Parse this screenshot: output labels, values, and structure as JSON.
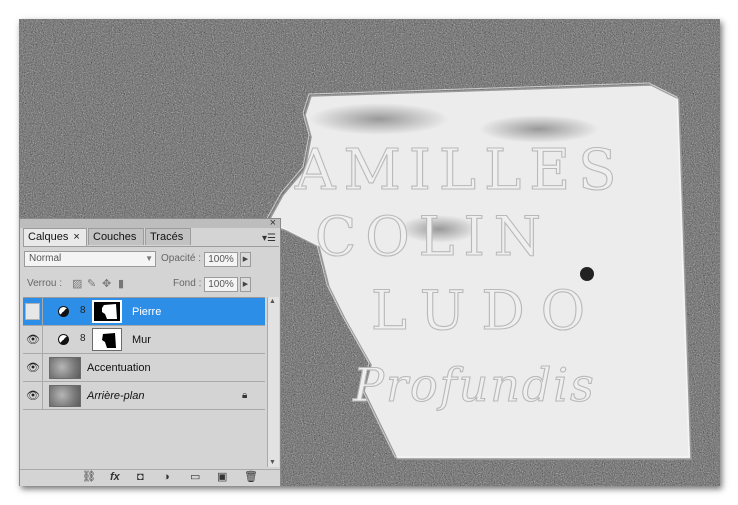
{
  "panel": {
    "close_glyph": "×",
    "menu_glyph": "▾☰",
    "tabs": [
      {
        "label": "Calques"
      },
      {
        "label": "Couches"
      },
      {
        "label": "Tracés"
      }
    ],
    "tab_close_glyph": "×",
    "blend_mode": "Normal",
    "opacity_label": "Opacité :",
    "opacity_value": "100%",
    "lock_label": "Verrou :",
    "fill_label": "Fond :",
    "fill_value": "100%",
    "layers": [
      {
        "name": "Pierre",
        "visible": false,
        "selected": true,
        "type": "adjustment"
      },
      {
        "name": "Mur",
        "visible": true,
        "selected": false,
        "type": "adjustment"
      },
      {
        "name": "Accentuation",
        "visible": true,
        "selected": false,
        "type": "pixel"
      },
      {
        "name": "Arrière-plan",
        "visible": true,
        "selected": false,
        "type": "background",
        "locked": true
      }
    ],
    "footer_fx": "fx"
  },
  "photo": {
    "plaque_lines": [
      "AMILLES",
      "COLIN",
      "LUDO",
      "Profundis"
    ]
  }
}
